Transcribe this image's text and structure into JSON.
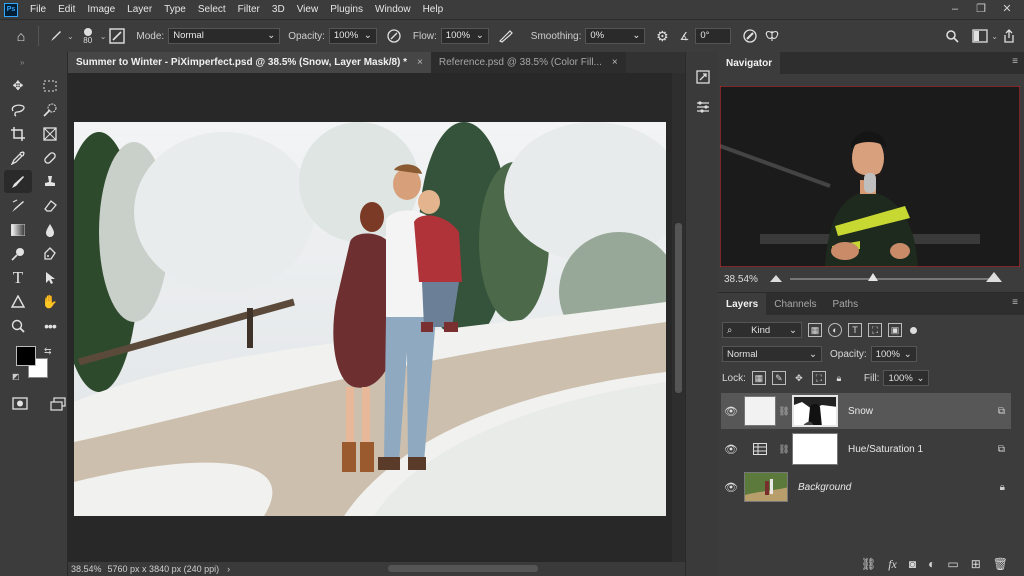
{
  "menu": [
    "File",
    "Edit",
    "Image",
    "Layer",
    "Type",
    "Select",
    "Filter",
    "3D",
    "View",
    "Plugins",
    "Window",
    "Help"
  ],
  "app_logo": "Ps",
  "window_controls": [
    "–",
    "❐",
    "✕"
  ],
  "options": {
    "brush_size": "80",
    "mode_label": "Mode:",
    "mode_value": "Normal",
    "opacity_label": "Opacity:",
    "opacity_value": "100%",
    "flow_label": "Flow:",
    "flow_value": "100%",
    "smoothing_label": "Smoothing:",
    "smoothing_value": "0%",
    "angle_value": "0°"
  },
  "tabs": [
    {
      "label": "Summer to Winter - PiXimperfect.psd @ 38.5% (Snow, Layer Mask/8) *",
      "close": "×"
    },
    {
      "label": "Reference.psd @ 38.5% (Color Fill...",
      "close": "×"
    }
  ],
  "status": {
    "zoom": "38.54%",
    "dimensions": "5760 px x 3840 px (240 ppi)",
    "arrow": "›"
  },
  "navigator": {
    "tab": "Navigator",
    "zoom": "38.54%"
  },
  "layers_panel": {
    "tabs": [
      "Layers",
      "Channels",
      "Paths"
    ],
    "kind_label": "Kind",
    "blend_mode": "Normal",
    "opacity_label": "Opacity:",
    "opacity_value": "100%",
    "lock_label": "Lock:",
    "fill_label": "Fill:",
    "fill_value": "100%",
    "layers": [
      {
        "name": "Snow",
        "selected": true
      },
      {
        "name": "Hue/Saturation 1",
        "selected": false
      },
      {
        "name": "Background",
        "selected": false
      }
    ]
  },
  "colors": {
    "foreground": "#000000",
    "background": "#ffffff",
    "accent": "#31a8ff"
  },
  "icons": {
    "options_bar": [
      "home-icon",
      "brush-icon",
      "brush-settings-icon",
      "pressure-opacity-icon",
      "airbrush-icon",
      "smoothing-gear-icon",
      "angle-icon",
      "pressure-size-icon",
      "symmetry-icon",
      "search-icon",
      "workspace-icon",
      "share-icon"
    ],
    "tools": [
      "move-icon",
      "marquee-icon",
      "lasso-icon",
      "quick-select-icon",
      "crop-icon",
      "frame-icon",
      "eyedropper-icon",
      "healing-icon",
      "brush-icon",
      "stamp-icon",
      "history-brush-icon",
      "eraser-icon",
      "gradient-icon",
      "blur-icon",
      "dodge-icon",
      "pen-icon",
      "type-icon",
      "path-select-icon",
      "shape-icon",
      "hand-icon",
      "zoom-icon",
      "more-tools-icon"
    ]
  }
}
